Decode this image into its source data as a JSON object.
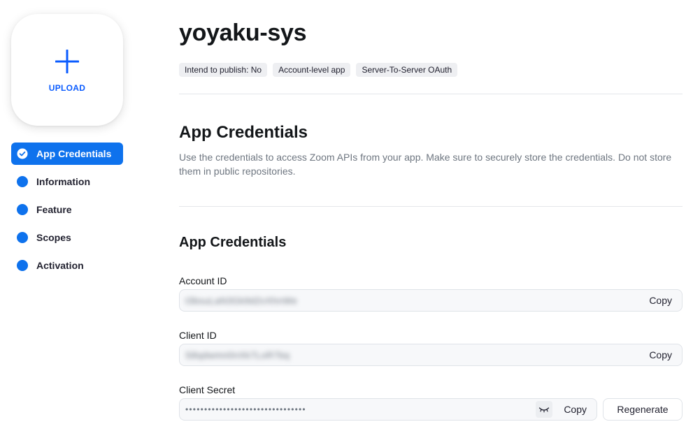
{
  "upload": {
    "label": "UPLOAD",
    "icon": "plus-icon"
  },
  "sidebar": {
    "items": [
      {
        "label": "App Credentials",
        "active": true,
        "icon": "check-circle-icon"
      },
      {
        "label": "Information",
        "active": false
      },
      {
        "label": "Feature",
        "active": false
      },
      {
        "label": "Scopes",
        "active": false
      },
      {
        "label": "Activation",
        "active": false
      }
    ]
  },
  "header": {
    "app_name": "yoyaku-sys",
    "badges": [
      "Intend to publish: No",
      "Account-level app",
      "Server-To-Server OAuth"
    ]
  },
  "credentials_section": {
    "title": "App Credentials",
    "description": "Use the credentials to access Zoom APIs from your app. Make sure to securely store the credentials. Do not store them in public repositories.",
    "subtitle": "App Credentials"
  },
  "fields": {
    "account_id": {
      "label": "Account ID",
      "value": "t3bsuLaN3Gk9d2vXhnWe",
      "copy_label": "Copy"
    },
    "client_id": {
      "label": "Client ID",
      "value": "S8qdwmn0nXk7LoR7bq",
      "copy_label": "Copy"
    },
    "client_secret": {
      "label": "Client Secret",
      "value": "••••••••••••••••••••••••••••••••",
      "copy_label": "Copy",
      "toggle_icon": "eye-closed-icon",
      "regenerate_label": "Regenerate"
    }
  },
  "colors": {
    "accent": "#0e72ed",
    "link": "#0b5cff",
    "text": "#131619",
    "muted": "#6e7680"
  }
}
